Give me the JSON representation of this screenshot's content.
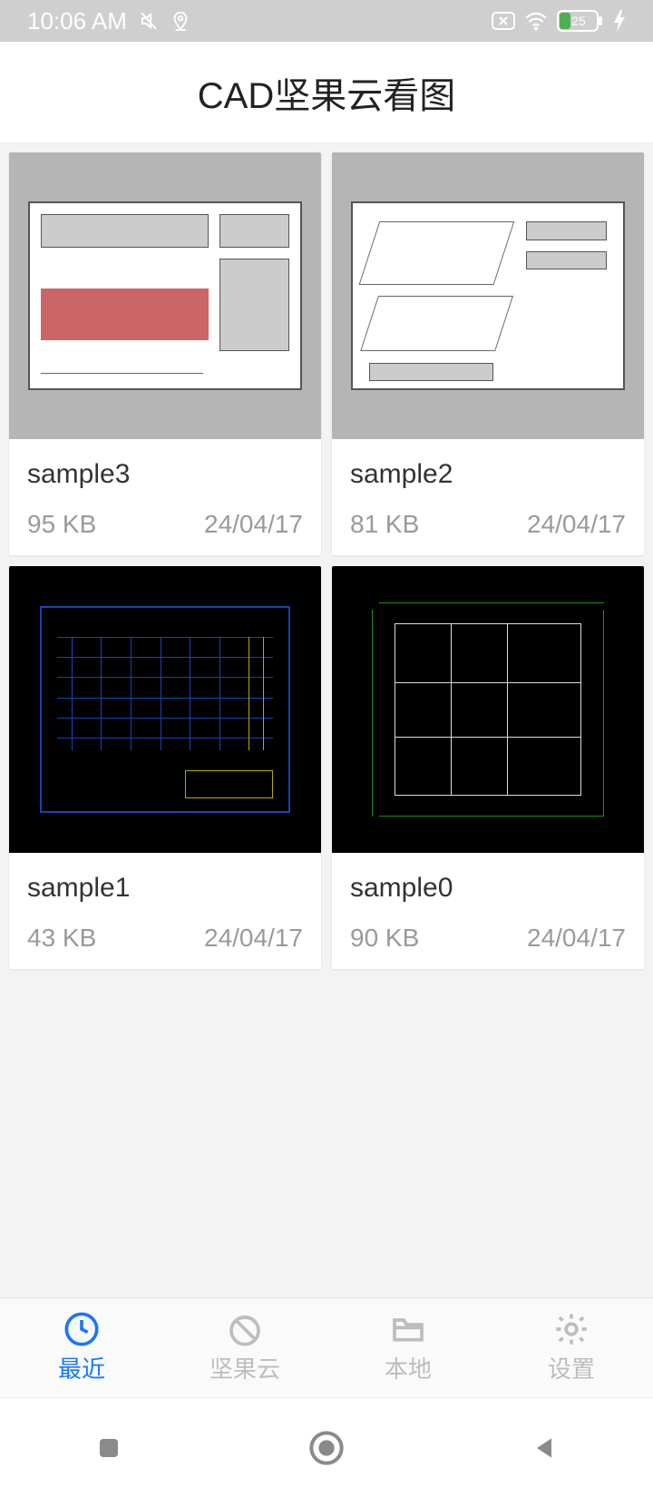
{
  "status": {
    "time": "10:06 AM",
    "battery": "25"
  },
  "header": {
    "title": "CAD坚果云看图"
  },
  "files": [
    {
      "name": "sample3",
      "size": "95 KB",
      "date": "24/04/17"
    },
    {
      "name": "sample2",
      "size": "81 KB",
      "date": "24/04/17"
    },
    {
      "name": "sample1",
      "size": "43 KB",
      "date": "24/04/17"
    },
    {
      "name": "sample0",
      "size": "90 KB",
      "date": "24/04/17"
    }
  ],
  "nav": {
    "recent": "最近",
    "cloud": "坚果云",
    "local": "本地",
    "settings": "设置"
  }
}
